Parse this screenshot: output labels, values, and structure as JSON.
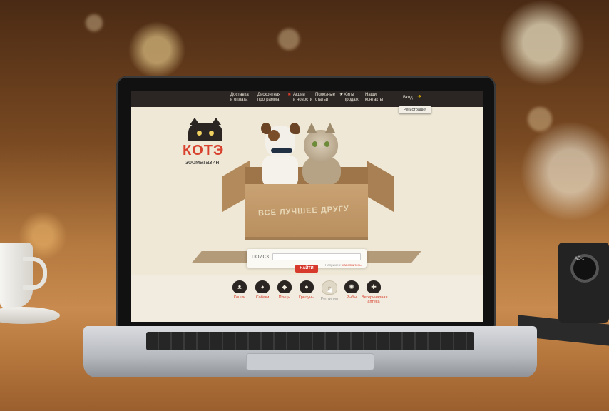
{
  "nav": {
    "items": [
      {
        "label": "Доставка\nи оплата"
      },
      {
        "label": "Дисконтная\nпрограмма"
      },
      {
        "label": "Акции\nи новости"
      },
      {
        "label": "Полезные\nстатьи"
      },
      {
        "label": "Хиты\nпродаж"
      },
      {
        "label": "Наши\nконтакты"
      }
    ],
    "login_label": "Вход",
    "register_label": "Регистрация"
  },
  "logo": {
    "title": "КОТЭ",
    "subtitle": "зоомагазин"
  },
  "hero": {
    "box_text": "ВСЕ ЛУЧШЕЕ ДРУГУ"
  },
  "search": {
    "label": "ПОИСК",
    "placeholder": "",
    "hint_prefix": "Например:",
    "hint_example": "наполнитель",
    "button_label": "НАЙТИ"
  },
  "categories": [
    {
      "label": "Кошки",
      "icon": "cat-icon"
    },
    {
      "label": "Собаки",
      "icon": "dog-icon"
    },
    {
      "label": "Птицы",
      "icon": "bird-icon"
    },
    {
      "label": "Грызуны",
      "icon": "rodent-icon"
    },
    {
      "label": "Рептилии",
      "icon": "reptile-icon",
      "active": true
    },
    {
      "label": "Рыбы",
      "icon": "fish-icon"
    },
    {
      "label": "Ветеринарная\nаптека",
      "icon": "vet-pharmacy-icon"
    }
  ],
  "camera_brand": "AE-1",
  "colors": {
    "accent": "#d73a2c",
    "nav_bg": "#2b2623",
    "page_bg": "#efe8d6"
  }
}
